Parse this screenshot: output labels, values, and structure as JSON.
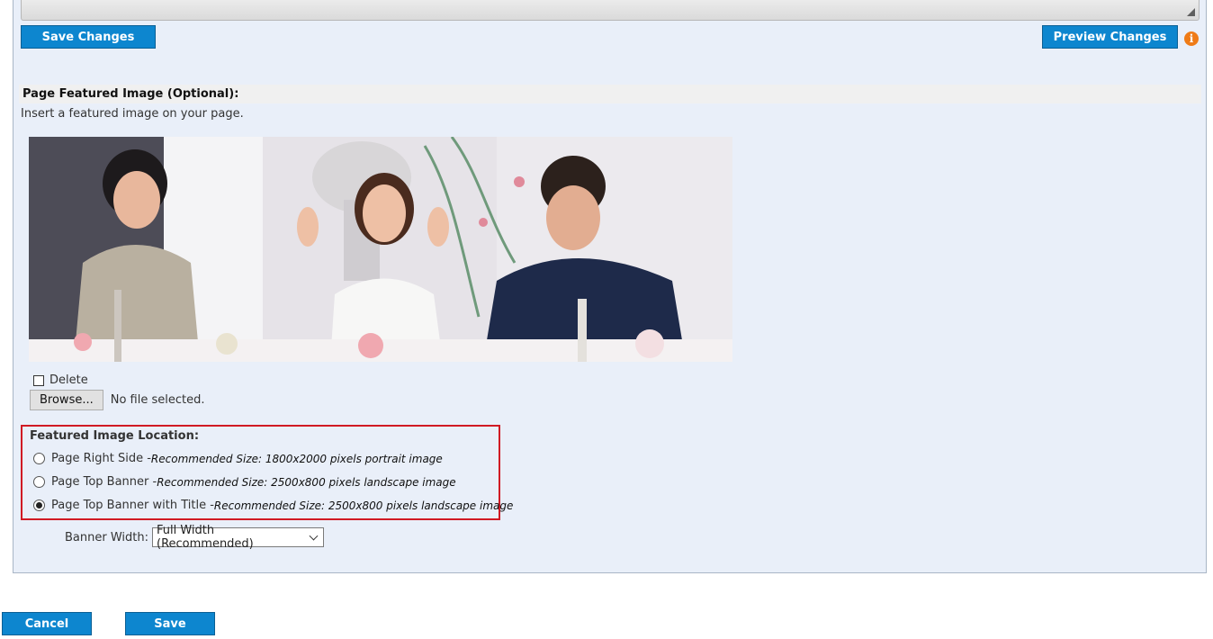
{
  "toolbar": {
    "save_changes_label": "Save Changes",
    "preview_changes_label": "Preview Changes",
    "info_icon": "i"
  },
  "featured_section": {
    "header": "Page Featured Image (Optional):",
    "description": "Insert a featured image on your page.",
    "image_alt": "wedding-party-photo",
    "delete_label": "Delete",
    "delete_checked": false,
    "browse_label": "Browse...",
    "file_status": "No file selected."
  },
  "location": {
    "title": "Featured Image Location:",
    "options": [
      {
        "label": "Page Right Side - ",
        "recommended": "Recommended Size: 1800x2000 pixels portrait image",
        "checked": false
      },
      {
        "label": "Page Top Banner - ",
        "recommended": "Recommended Size: 2500x800 pixels landscape image",
        "checked": false
      },
      {
        "label": "Page Top Banner with Title - ",
        "recommended": "Recommended Size: 2500x800 pixels landscape image",
        "checked": true
      }
    ]
  },
  "banner_width": {
    "label": "Banner Width:",
    "selected": "Full Width (Recommended)"
  },
  "footer": {
    "cancel_label": "Cancel",
    "save_label": "Save"
  },
  "colors": {
    "button_blue": "#0d86cf",
    "info_orange": "#ef7b17",
    "highlight_red": "#d01a24",
    "panel_bg": "#e9eff9"
  }
}
